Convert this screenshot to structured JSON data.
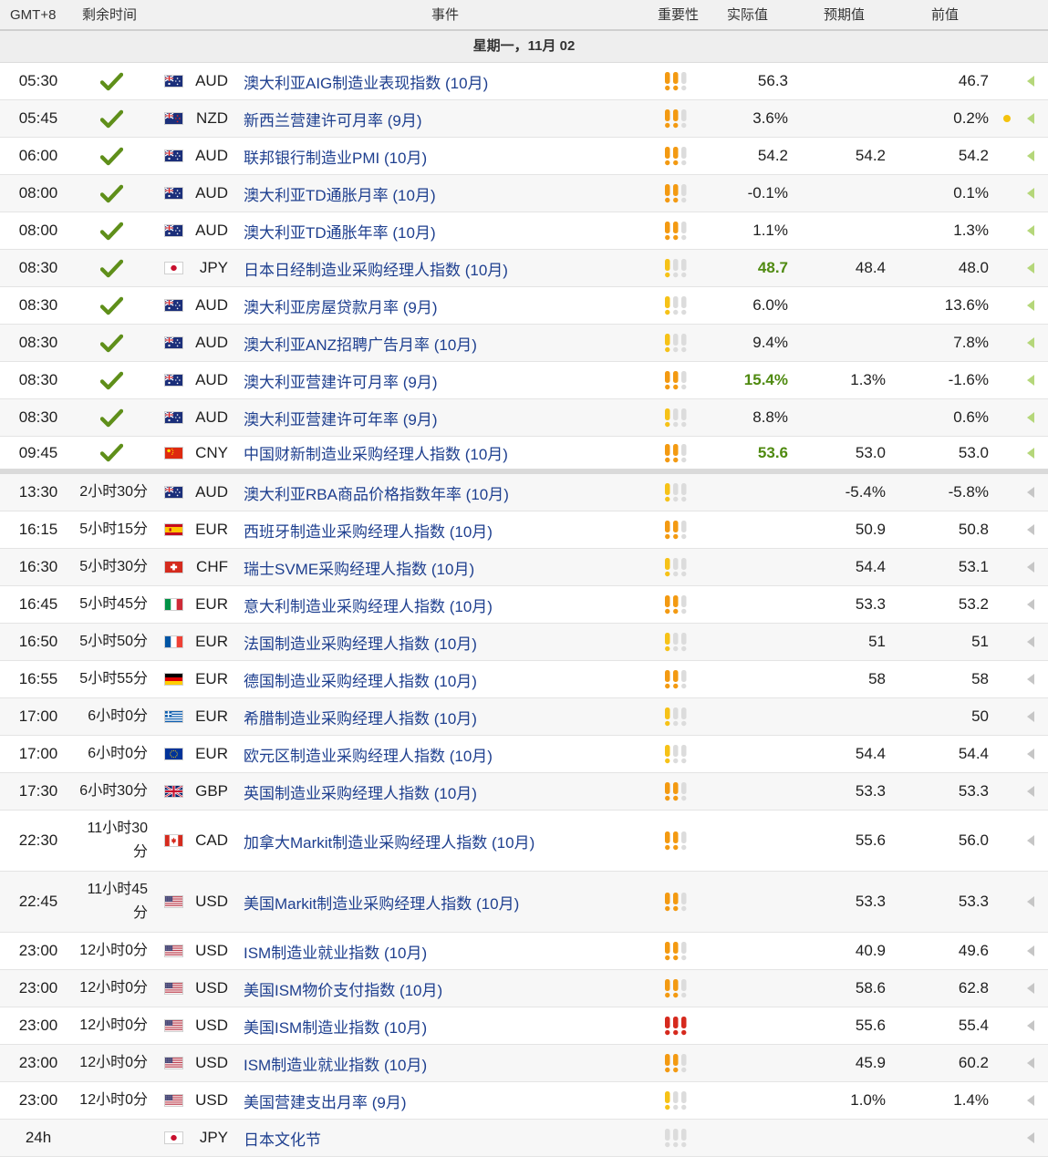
{
  "header": {
    "tz": "GMT+8",
    "remaining": "剩余时间",
    "event": "事件",
    "importance": "重要性",
    "actual": "实际值",
    "forecast": "预期值",
    "previous": "前值"
  },
  "day_label": "星期一，11月 02",
  "colors": {
    "imp_high": "#d62a1e",
    "imp_mid": "#f39a12",
    "imp_low": "#f6c218",
    "imp_off": "#dcdcdc",
    "check": "#5f8f1a",
    "actual_up": "#4f8a10",
    "event_text": "#1e3f8f"
  },
  "rows": [
    {
      "time": "05:30",
      "remaining": "",
      "done": true,
      "flag": "au",
      "currency": "AUD",
      "event": "澳大利亚AIG制造业表现指数 (10月)",
      "importance": 2,
      "actual": "56.3",
      "actual_green": false,
      "forecast": "",
      "previous": "46.7",
      "dot": false
    },
    {
      "time": "05:45",
      "remaining": "",
      "done": true,
      "flag": "nz",
      "currency": "NZD",
      "event": "新西兰营建许可月率 (9月)",
      "importance": 2,
      "actual": "3.6%",
      "actual_green": false,
      "forecast": "",
      "previous": "0.2%",
      "dot": true
    },
    {
      "time": "06:00",
      "remaining": "",
      "done": true,
      "flag": "au",
      "currency": "AUD",
      "event": "联邦银行制造业PMI (10月)",
      "importance": 2,
      "actual": "54.2",
      "actual_green": false,
      "forecast": "54.2",
      "previous": "54.2",
      "dot": false
    },
    {
      "time": "08:00",
      "remaining": "",
      "done": true,
      "flag": "au",
      "currency": "AUD",
      "event": "澳大利亚TD通胀月率 (10月)",
      "importance": 2,
      "actual": "-0.1%",
      "actual_green": false,
      "forecast": "",
      "previous": "0.1%",
      "dot": false
    },
    {
      "time": "08:00",
      "remaining": "",
      "done": true,
      "flag": "au",
      "currency": "AUD",
      "event": "澳大利亚TD通胀年率 (10月)",
      "importance": 2,
      "actual": "1.1%",
      "actual_green": false,
      "forecast": "",
      "previous": "1.3%",
      "dot": false
    },
    {
      "time": "08:30",
      "remaining": "",
      "done": true,
      "flag": "jp",
      "currency": "JPY",
      "event": "日本日经制造业采购经理人指数 (10月)",
      "importance": 1,
      "actual": "48.7",
      "actual_green": true,
      "forecast": "48.4",
      "previous": "48.0",
      "dot": false
    },
    {
      "time": "08:30",
      "remaining": "",
      "done": true,
      "flag": "au",
      "currency": "AUD",
      "event": "澳大利亚房屋贷款月率 (9月)",
      "importance": 1,
      "actual": "6.0%",
      "actual_green": false,
      "forecast": "",
      "previous": "13.6%",
      "dot": false
    },
    {
      "time": "08:30",
      "remaining": "",
      "done": true,
      "flag": "au",
      "currency": "AUD",
      "event": "澳大利亚ANZ招聘广告月率 (10月)",
      "importance": 1,
      "actual": "9.4%",
      "actual_green": false,
      "forecast": "",
      "previous": "7.8%",
      "dot": false
    },
    {
      "time": "08:30",
      "remaining": "",
      "done": true,
      "flag": "au",
      "currency": "AUD",
      "event": "澳大利亚营建许可月率 (9月)",
      "importance": 2,
      "actual": "15.4%",
      "actual_green": true,
      "forecast": "1.3%",
      "previous": "-1.6%",
      "dot": false
    },
    {
      "time": "08:30",
      "remaining": "",
      "done": true,
      "flag": "au",
      "currency": "AUD",
      "event": "澳大利亚营建许可年率 (9月)",
      "importance": 1,
      "actual": "8.8%",
      "actual_green": false,
      "forecast": "",
      "previous": "0.6%",
      "dot": false
    },
    {
      "time": "09:45",
      "remaining": "",
      "done": true,
      "flag": "cn",
      "currency": "CNY",
      "event": "中国财新制造业采购经理人指数 (10月)",
      "importance": 2,
      "actual": "53.6",
      "actual_green": true,
      "forecast": "53.0",
      "previous": "53.0",
      "dot": false
    },
    {
      "time": "13:30",
      "remaining": "2小时30分",
      "done": false,
      "flag": "au",
      "currency": "AUD",
      "event": "澳大利亚RBA商品价格指数年率 (10月)",
      "importance": 1,
      "actual": "",
      "actual_green": false,
      "forecast": "-5.4%",
      "previous": "-5.8%",
      "dot": false
    },
    {
      "time": "16:15",
      "remaining": "5小时15分",
      "done": false,
      "flag": "es",
      "currency": "EUR",
      "event": "西班牙制造业采购经理人指数 (10月)",
      "importance": 2,
      "actual": "",
      "actual_green": false,
      "forecast": "50.9",
      "previous": "50.8",
      "dot": false
    },
    {
      "time": "16:30",
      "remaining": "5小时30分",
      "done": false,
      "flag": "ch",
      "currency": "CHF",
      "event": "瑞士SVME采购经理人指数 (10月)",
      "importance": 1,
      "actual": "",
      "actual_green": false,
      "forecast": "54.4",
      "previous": "53.1",
      "dot": false
    },
    {
      "time": "16:45",
      "remaining": "5小时45分",
      "done": false,
      "flag": "it",
      "currency": "EUR",
      "event": "意大利制造业采购经理人指数 (10月)",
      "importance": 2,
      "actual": "",
      "actual_green": false,
      "forecast": "53.3",
      "previous": "53.2",
      "dot": false
    },
    {
      "time": "16:50",
      "remaining": "5小时50分",
      "done": false,
      "flag": "fr",
      "currency": "EUR",
      "event": "法国制造业采购经理人指数 (10月)",
      "importance": 1,
      "actual": "",
      "actual_green": false,
      "forecast": "51",
      "previous": "51",
      "dot": false
    },
    {
      "time": "16:55",
      "remaining": "5小时55分",
      "done": false,
      "flag": "de",
      "currency": "EUR",
      "event": "德国制造业采购经理人指数 (10月)",
      "importance": 2,
      "actual": "",
      "actual_green": false,
      "forecast": "58",
      "previous": "58",
      "dot": false
    },
    {
      "time": "17:00",
      "remaining": "6小时0分",
      "done": false,
      "flag": "gr",
      "currency": "EUR",
      "event": "希腊制造业采购经理人指数 (10月)",
      "importance": 1,
      "actual": "",
      "actual_green": false,
      "forecast": "",
      "previous": "50",
      "dot": false
    },
    {
      "time": "17:00",
      "remaining": "6小时0分",
      "done": false,
      "flag": "eu",
      "currency": "EUR",
      "event": "欧元区制造业采购经理人指数 (10月)",
      "importance": 1,
      "actual": "",
      "actual_green": false,
      "forecast": "54.4",
      "previous": "54.4",
      "dot": false
    },
    {
      "time": "17:30",
      "remaining": "6小时30分",
      "done": false,
      "flag": "gb",
      "currency": "GBP",
      "event": "英国制造业采购经理人指数 (10月)",
      "importance": 2,
      "actual": "",
      "actual_green": false,
      "forecast": "53.3",
      "previous": "53.3",
      "dot": false
    },
    {
      "time": "22:30",
      "remaining": "11小时30分",
      "done": false,
      "flag": "ca",
      "currency": "CAD",
      "event": "加拿大Markit制造业采购经理人指数 (10月)",
      "importance": 2,
      "actual": "",
      "actual_green": false,
      "forecast": "55.6",
      "previous": "56.0",
      "dot": false,
      "tall": true
    },
    {
      "time": "22:45",
      "remaining": "11小时45分",
      "done": false,
      "flag": "us",
      "currency": "USD",
      "event": "美国Markit制造业采购经理人指数 (10月)",
      "importance": 2,
      "actual": "",
      "actual_green": false,
      "forecast": "53.3",
      "previous": "53.3",
      "dot": false,
      "tall": true
    },
    {
      "time": "23:00",
      "remaining": "12小时0分",
      "done": false,
      "flag": "us",
      "currency": "USD",
      "event": "ISM制造业就业指数 (10月)",
      "importance": 2,
      "actual": "",
      "actual_green": false,
      "forecast": "40.9",
      "previous": "49.6",
      "dot": false
    },
    {
      "time": "23:00",
      "remaining": "12小时0分",
      "done": false,
      "flag": "us",
      "currency": "USD",
      "event": "美国ISM物价支付指数 (10月)",
      "importance": 2,
      "actual": "",
      "actual_green": false,
      "forecast": "58.6",
      "previous": "62.8",
      "dot": false
    },
    {
      "time": "23:00",
      "remaining": "12小时0分",
      "done": false,
      "flag": "us",
      "currency": "USD",
      "event": "美国ISM制造业指数 (10月)",
      "importance": 3,
      "actual": "",
      "actual_green": false,
      "forecast": "55.6",
      "previous": "55.4",
      "dot": false
    },
    {
      "time": "23:00",
      "remaining": "12小时0分",
      "done": false,
      "flag": "us",
      "currency": "USD",
      "event": "ISM制造业就业指数 (10月)",
      "importance": 2,
      "actual": "",
      "actual_green": false,
      "forecast": "45.9",
      "previous": "60.2",
      "dot": false
    },
    {
      "time": "23:00",
      "remaining": "12小时0分",
      "done": false,
      "flag": "us",
      "currency": "USD",
      "event": "美国营建支出月率 (9月)",
      "importance": 1,
      "actual": "",
      "actual_green": false,
      "forecast": "1.0%",
      "previous": "1.4%",
      "dot": false
    },
    {
      "time": "24h",
      "remaining": "",
      "done": false,
      "flag": "jp",
      "currency": "JPY",
      "event": "日本文化节",
      "importance": 0,
      "actual": "",
      "actual_green": false,
      "forecast": "",
      "previous": "",
      "dot": false
    }
  ]
}
